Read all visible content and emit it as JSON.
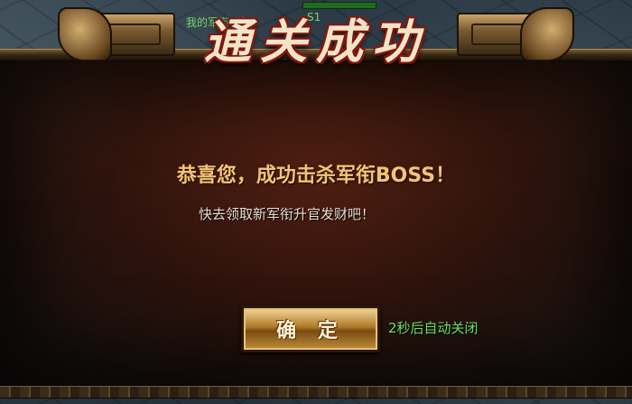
{
  "dialog": {
    "title": "通关成功",
    "message": "恭喜您，成功击杀军衔BOSS！",
    "submessage": "快去领取新军衔升官发财吧！",
    "confirm_label": "确 定",
    "autoclose_text": "2秒后自动关闭"
  },
  "hud": {
    "tag": "S1",
    "name_partial": "我的军衔1阶"
  },
  "colors": {
    "title_fill": "#f3e4c8",
    "title_outline": "#8a1a10",
    "message": "#f3c37a",
    "autoclose": "#6fe060"
  },
  "icons": [
    "dragon-ornament-left",
    "dragon-ornament-right"
  ]
}
